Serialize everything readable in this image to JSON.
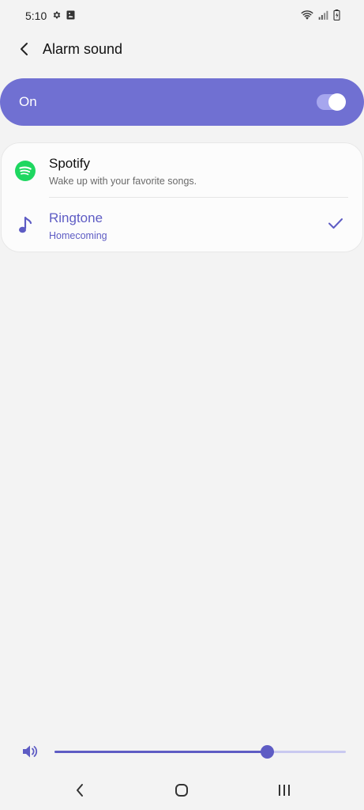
{
  "status_bar": {
    "time": "5:10",
    "left_icons": [
      "gear-icon",
      "image-notification-icon"
    ],
    "right_icons": [
      "wifi-icon",
      "signal-icon",
      "battery-charging-icon"
    ]
  },
  "header": {
    "title": "Alarm sound",
    "back_icon": "chevron-left-icon"
  },
  "master_switch": {
    "label": "On",
    "state": true
  },
  "options": [
    {
      "title": "Spotify",
      "subtitle": "Wake up with your favorite songs.",
      "icon": "spotify-icon",
      "selected": false
    },
    {
      "title": "Ringtone",
      "subtitle": "Homecoming",
      "icon": "music-note-icon",
      "selected": true
    }
  ],
  "volume": {
    "icon": "speaker-icon",
    "level": 0.73
  },
  "nav_bar": {
    "buttons": [
      "back-icon",
      "home-icon",
      "recents-icon"
    ]
  },
  "colors": {
    "accent": "#5e5cc4",
    "switch_bar": "#7070d2",
    "spotify_green": "#1ed760",
    "background": "#f3f3f3"
  }
}
